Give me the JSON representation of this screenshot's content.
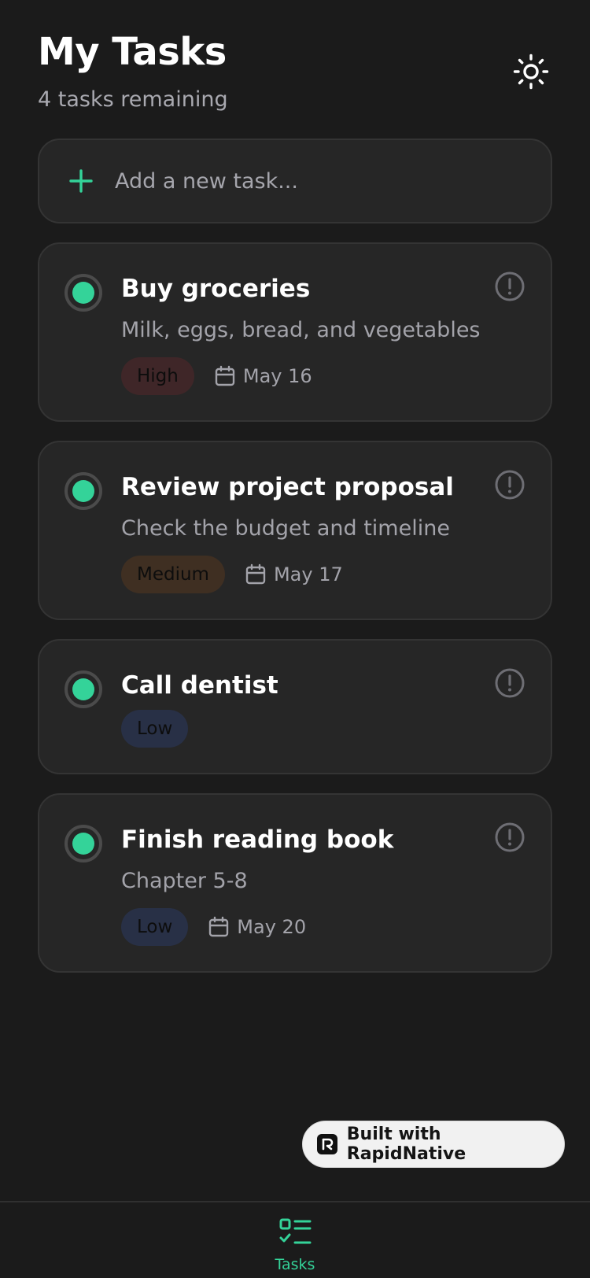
{
  "header": {
    "title": "My Tasks",
    "subtitle": "4 tasks remaining",
    "theme_icon": "sun-icon"
  },
  "add_task": {
    "placeholder": "Add a new task...",
    "icon": "plus-icon"
  },
  "tasks": [
    {
      "title": "Buy groceries",
      "description": "Milk, eggs, bread, and vegetables",
      "priority": "High",
      "due": "May 16"
    },
    {
      "title": "Review project proposal",
      "description": "Check the budget and timeline",
      "priority": "Medium",
      "due": "May 17"
    },
    {
      "title": "Call dentist",
      "description": "",
      "priority": "Low",
      "due": ""
    },
    {
      "title": "Finish reading book",
      "description": "Chapter 5-8",
      "priority": "Low",
      "due": "May 20"
    }
  ],
  "built_with": {
    "label": "Built with RapidNative"
  },
  "tab_bar": {
    "tasks_label": "Tasks"
  },
  "colors": {
    "background": "#1b1b1b",
    "card": "#262626",
    "accent": "#34d399",
    "priority_high": "#3f2628",
    "priority_medium": "#3f2f22",
    "priority_low": "#283046"
  }
}
